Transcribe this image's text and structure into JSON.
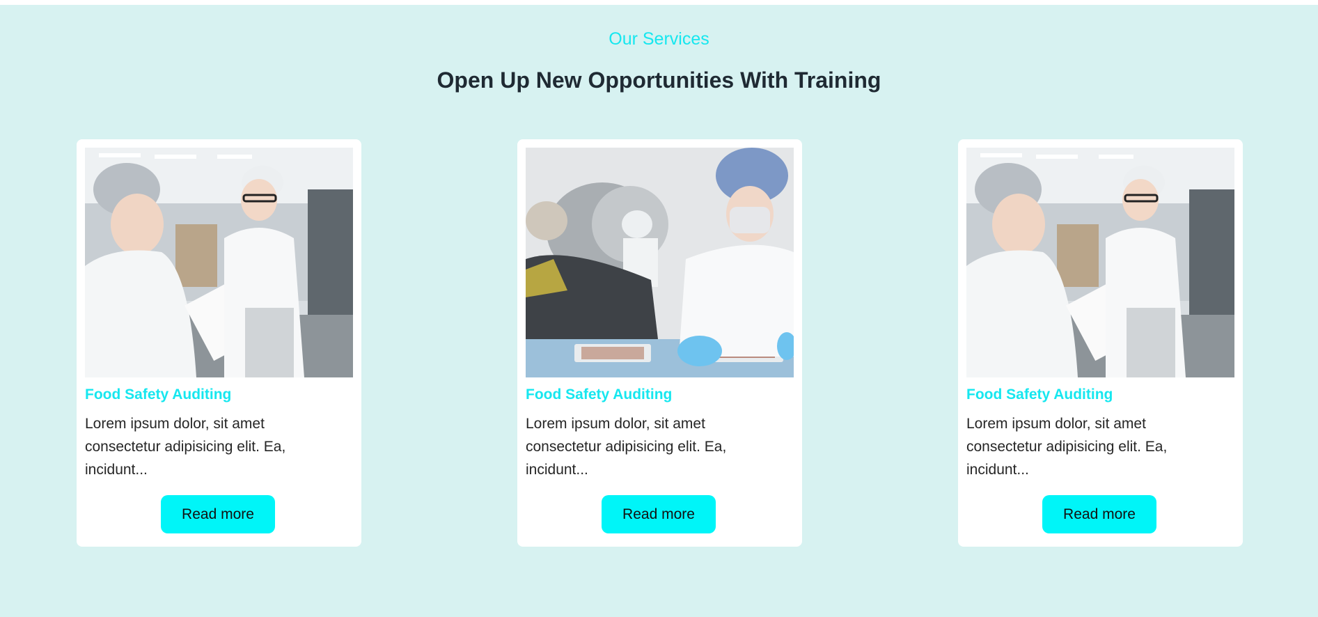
{
  "section": {
    "eyebrow": "Our Services",
    "title": "Open Up New Opportunities With Training"
  },
  "cards": [
    {
      "title": "Food Safety Auditing",
      "text": "Lorem ipsum dolor, sit amet consectetur adipisicing elit. Ea, incidunt...",
      "button": "Read more",
      "image": "factory-auditors-photo"
    },
    {
      "title": "Food Safety Auditing",
      "text": "Lorem ipsum dolor, sit amet consectetur adipisicing elit. Ea, incidunt...",
      "button": "Read more",
      "image": "lab-worker-gloves-photo"
    },
    {
      "title": "Food Safety Auditing",
      "text": "Lorem ipsum dolor, sit amet consectetur adipisicing elit. Ea, incidunt...",
      "button": "Read more",
      "image": "factory-auditors-photo"
    }
  ],
  "colors": {
    "background": "#d7f2f1",
    "accent": "#16e7ef",
    "button": "#00f5f8",
    "heading": "#1f2a33"
  }
}
